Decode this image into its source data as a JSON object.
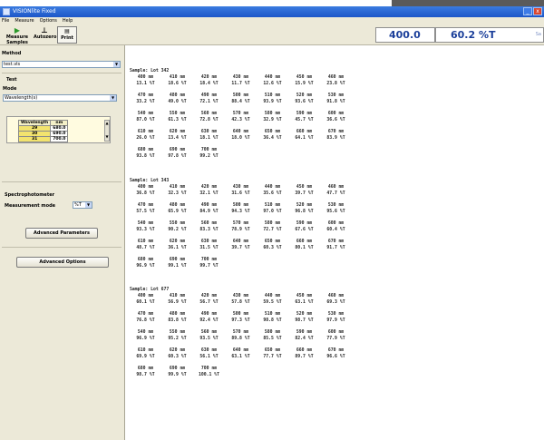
{
  "window": {
    "title": "VISIONlite Fixed",
    "btn_min": "_",
    "btn_close": "x"
  },
  "menu": [
    "File",
    "Measure",
    "Options",
    "Help"
  ],
  "toolbar": {
    "measure_label": "Measure Samples",
    "autozero_label": "Autozero",
    "print_label": "Print",
    "wavelength_readout": "400.0 nm",
    "transmittance_readout": "60.2 %T",
    "readout_extra": "Sa"
  },
  "left_panel": {
    "method_label": "Method",
    "method_value": "test.vls",
    "test_label": "Test",
    "mode_label": "Mode",
    "mode_value": "Wavelength(s)",
    "wavelength_table": {
      "headers": [
        "Wavelength",
        "nm"
      ],
      "rows": [
        [
          "29",
          "680.0"
        ],
        [
          "30",
          "690.0"
        ],
        [
          "31",
          "700.0"
        ]
      ]
    },
    "spectro_label": "Spectrophotometer",
    "measurement_mode_label": "Measurement mode",
    "measurement_mode_value": "%T",
    "advanced_parameters_label": "Advanced Parameters",
    "advanced_options_label": "Advanced Options"
  },
  "results": [
    {
      "title": "Sample: Lot 342",
      "blocks": [
        {
          "wl": [
            "400 nm",
            "410 nm",
            "420 nm",
            "430 nm",
            "440 nm",
            "450 nm",
            "460 nm"
          ],
          "vals": [
            "13.1 %T",
            "18.6 %T",
            "18.4 %T",
            "11.7 %T",
            "12.6 %T",
            "15.9 %T",
            "23.8 %T"
          ]
        },
        {
          "wl": [
            "470 nm",
            "480 nm",
            "490 nm",
            "500 nm",
            "510 nm",
            "520 nm",
            "530 nm"
          ],
          "vals": [
            "33.2 %T",
            "49.0 %T",
            "72.1 %T",
            "88.4 %T",
            "93.9 %T",
            "93.6 %T",
            "91.8 %T"
          ]
        },
        {
          "wl": [
            "540 nm",
            "550 nm",
            "560 nm",
            "570 nm",
            "580 nm",
            "590 nm",
            "600 nm"
          ],
          "vals": [
            "87.0 %T",
            "61.3 %T",
            "72.8 %T",
            "42.3 %T",
            "32.9 %T",
            "45.7 %T",
            "36.6 %T"
          ]
        },
        {
          "wl": [
            "610 nm",
            "620 nm",
            "630 nm",
            "640 nm",
            "650 nm",
            "660 nm",
            "670 nm"
          ],
          "vals": [
            "26.0 %T",
            "13.4 %T",
            "18.1 %T",
            "18.0 %T",
            "36.4 %T",
            "64.1 %T",
            "83.9 %T"
          ]
        },
        {
          "wl": [
            "680 nm",
            "690 nm",
            "700 nm"
          ],
          "vals": [
            "93.8 %T",
            "97.8 %T",
            "99.2 %T"
          ]
        }
      ]
    },
    {
      "title": "Sample: Lot 343",
      "blocks": [
        {
          "wl": [
            "400 nm",
            "410 nm",
            "420 nm",
            "430 nm",
            "440 nm",
            "450 nm",
            "460 nm"
          ],
          "vals": [
            "36.8 %T",
            "32.3 %T",
            "32.1 %T",
            "31.6 %T",
            "35.6 %T",
            "39.7 %T",
            "47.7 %T"
          ]
        },
        {
          "wl": [
            "470 nm",
            "480 nm",
            "490 nm",
            "500 nm",
            "510 nm",
            "520 nm",
            "530 nm"
          ],
          "vals": [
            "57.5 %T",
            "65.9 %T",
            "84.9 %T",
            "94.3 %T",
            "97.0 %T",
            "96.8 %T",
            "95.6 %T"
          ]
        },
        {
          "wl": [
            "540 nm",
            "550 nm",
            "560 nm",
            "570 nm",
            "580 nm",
            "590 nm",
            "600 nm"
          ],
          "vals": [
            "93.3 %T",
            "90.2 %T",
            "83.3 %T",
            "78.9 %T",
            "72.7 %T",
            "67.6 %T",
            "60.4 %T"
          ]
        },
        {
          "wl": [
            "610 nm",
            "620 nm",
            "630 nm",
            "640 nm",
            "650 nm",
            "660 nm",
            "670 nm"
          ],
          "vals": [
            "48.7 %T",
            "36.1 %T",
            "31.5 %T",
            "39.7 %T",
            "60.3 %T",
            "80.1 %T",
            "91.7 %T"
          ]
        },
        {
          "wl": [
            "680 nm",
            "690 nm",
            "700 nm"
          ],
          "vals": [
            "96.9 %T",
            "99.1 %T",
            "99.7 %T"
          ]
        }
      ]
    },
    {
      "title": "Sample: Lot 677",
      "blocks": [
        {
          "wl": [
            "400 nm",
            "410 nm",
            "420 nm",
            "430 nm",
            "440 nm",
            "450 nm",
            "460 nm"
          ],
          "vals": [
            "60.1 %T",
            "56.9 %T",
            "56.7 %T",
            "57.8 %T",
            "59.5 %T",
            "63.1 %T",
            "69.3 %T"
          ]
        },
        {
          "wl": [
            "470 nm",
            "480 nm",
            "490 nm",
            "500 nm",
            "510 nm",
            "520 nm",
            "530 nm"
          ],
          "vals": [
            "76.8 %T",
            "83.8 %T",
            "92.4 %T",
            "97.3 %T",
            "98.8 %T",
            "98.7 %T",
            "97.9 %T"
          ]
        },
        {
          "wl": [
            "540 nm",
            "550 nm",
            "560 nm",
            "570 nm",
            "580 nm",
            "590 nm",
            "600 nm"
          ],
          "vals": [
            "96.9 %T",
            "95.2 %T",
            "93.5 %T",
            "89.8 %T",
            "85.5 %T",
            "82.4 %T",
            "77.9 %T"
          ]
        },
        {
          "wl": [
            "610 nm",
            "620 nm",
            "630 nm",
            "640 nm",
            "650 nm",
            "660 nm",
            "670 nm"
          ],
          "vals": [
            "69.9 %T",
            "60.3 %T",
            "56.1 %T",
            "63.1 %T",
            "77.7 %T",
            "89.7 %T",
            "96.6 %T"
          ]
        },
        {
          "wl": [
            "680 nm",
            "690 nm",
            "700 nm"
          ],
          "vals": [
            "98.7 %T",
            "99.9 %T",
            "100.1 %T"
          ]
        }
      ]
    }
  ]
}
